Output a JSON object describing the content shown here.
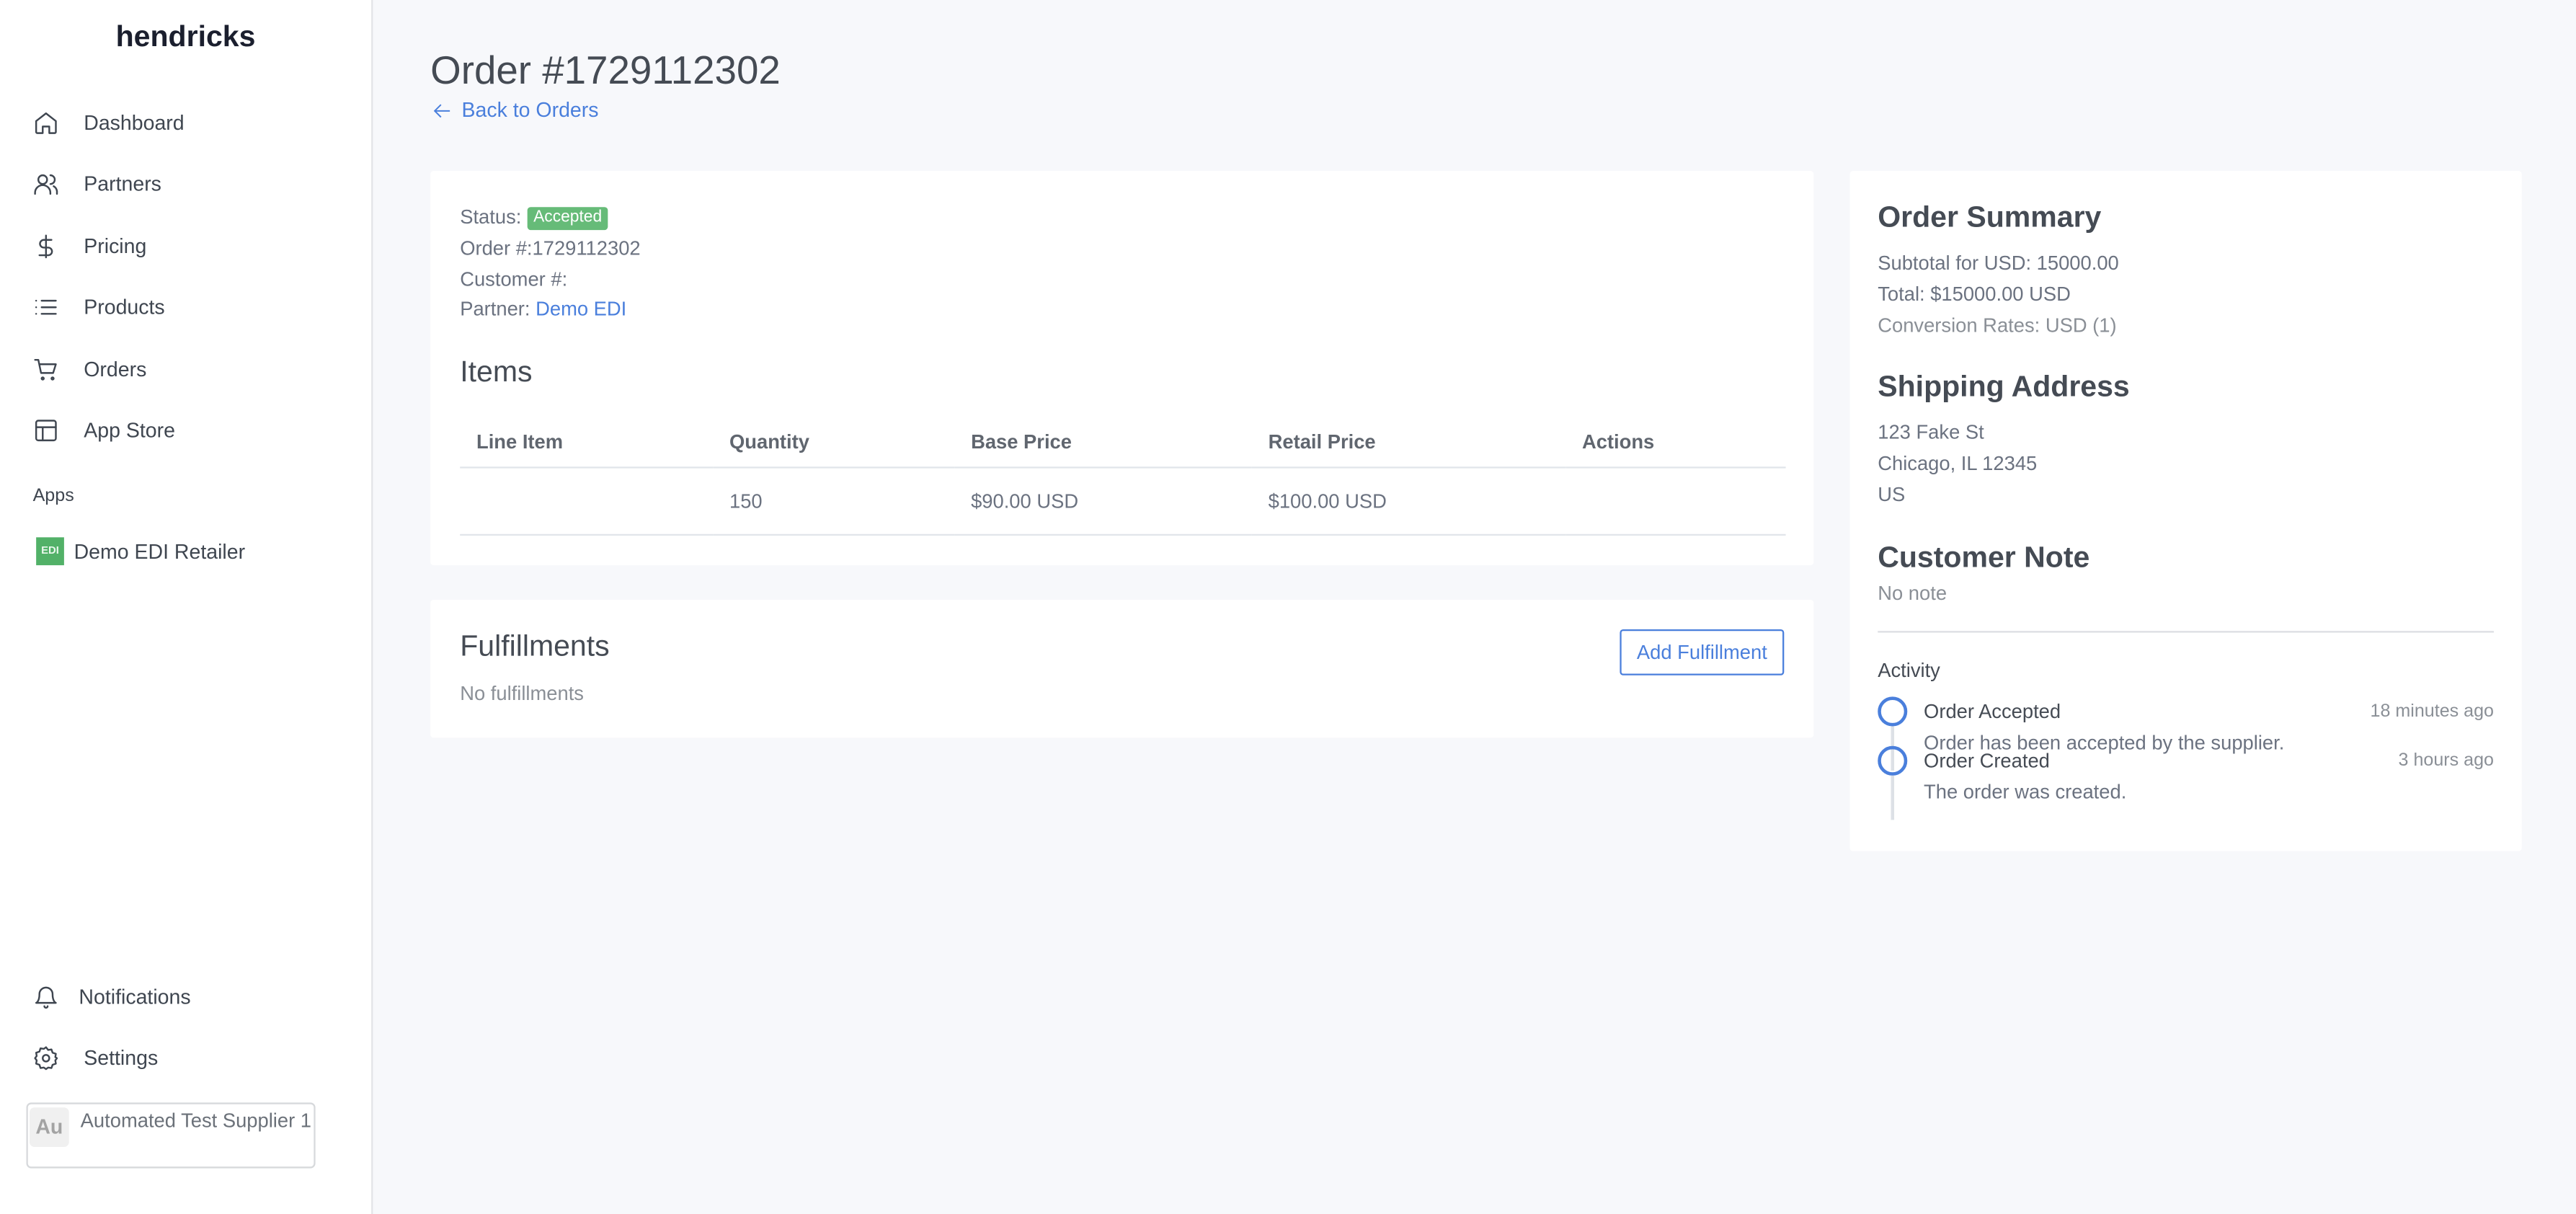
{
  "app": {
    "brand": "hendricks"
  },
  "sidebar": {
    "items": [
      {
        "label": "Dashboard",
        "icon": "home-icon"
      },
      {
        "label": "Partners",
        "icon": "users-icon"
      },
      {
        "label": "Pricing",
        "icon": "dollar-icon"
      },
      {
        "label": "Products",
        "icon": "list-icon"
      },
      {
        "label": "Orders",
        "icon": "cart-icon"
      },
      {
        "label": "App Store",
        "icon": "layout-icon"
      }
    ],
    "apps_label": "Apps",
    "apps": [
      {
        "label": "Demo EDI Retailer",
        "badge": "EDI",
        "badge_color": "#52b168"
      }
    ],
    "bottom_items": [
      {
        "label": "Notifications",
        "icon": "bell-icon"
      },
      {
        "label": "Settings",
        "icon": "gear-icon"
      }
    ],
    "user": {
      "initials": "Au",
      "name": "Automated Test Supplier 1"
    }
  },
  "header": {
    "title": "Order #1729112302",
    "back_label": "Back to Orders"
  },
  "order_info": {
    "status_label": "Status:",
    "status_value": "Accepted",
    "status_color": "#66bb78",
    "order_number": "Order #:1729112302",
    "customer_number": "Customer #:",
    "partner_label": "Partner:",
    "partner_value": "Demo EDI"
  },
  "items": {
    "title": "Items",
    "columns": [
      "Line Item",
      "Quantity",
      "Base Price",
      "Retail Price",
      "Actions"
    ],
    "rows": [
      [
        "",
        "150",
        "$90.00 USD",
        "$100.00 USD",
        ""
      ]
    ]
  },
  "fulfillments": {
    "title": "Fulfillments",
    "empty": "No fulfillments",
    "add_label": "Add Fulfillment"
  },
  "summary": {
    "title": "Order Summary",
    "subtotal": "Subtotal for USD: 15000.00",
    "total": "Total: $15000.00 USD",
    "conversion": "Conversion Rates: USD (1)",
    "shipping_title": "Shipping Address",
    "address": [
      "123 Fake St",
      "Chicago, IL 12345",
      "US"
    ],
    "note_title": "Customer Note",
    "note": "No note",
    "activity_title": "Activity",
    "activity": [
      {
        "title": "Order Accepted",
        "time": "18 minutes ago",
        "desc": "Order has been accepted by the supplier."
      },
      {
        "title": "Order Created",
        "time": "3 hours ago",
        "desc": "The order was created."
      }
    ]
  },
  "colors": {
    "accent": "#4a7fdc",
    "background": "#f7f8fb"
  }
}
